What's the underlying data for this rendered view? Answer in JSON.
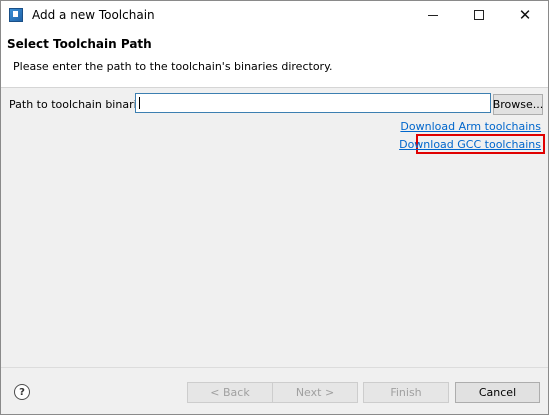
{
  "window": {
    "title": "Add a new Toolchain",
    "icon": "eclipse-app-icon",
    "controls": {
      "minimize": "minimize-icon",
      "maximize": "maximize-icon",
      "close": "close-icon"
    }
  },
  "header": {
    "title": "Select Toolchain Path",
    "description": "Please enter the path to the toolchain's binaries directory."
  },
  "form": {
    "path_label": "Path to toolchain binaries:",
    "path_value": "",
    "browse_label": "Browse..."
  },
  "links": {
    "arm": "Download Arm toolchains",
    "gcc": "Download GCC toolchains",
    "highlight_color": "#e00000"
  },
  "footer": {
    "help_icon": "help-icon",
    "help_glyph": "?",
    "back_label": "< Back",
    "next_label": "Next >",
    "finish_label": "Finish",
    "cancel_label": "Cancel"
  }
}
